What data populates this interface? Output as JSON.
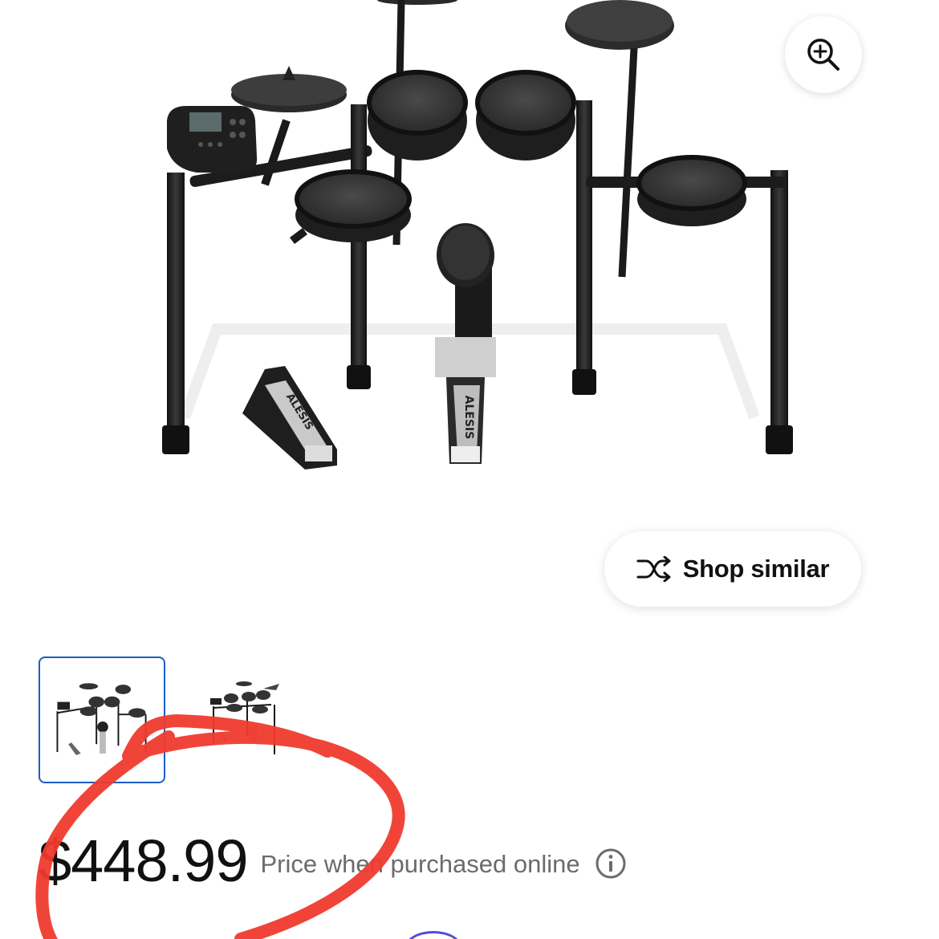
{
  "product": {
    "image_alt": "Alesis Nitro electronic drum kit",
    "brand_mark": "ALESIS"
  },
  "zoom": {
    "icon": "zoom-in-icon"
  },
  "shop_similar": {
    "label": "Shop similar",
    "icon": "shuffle-icon"
  },
  "thumbnails": [
    {
      "selected": true
    },
    {
      "selected": false
    }
  ],
  "price": {
    "amount": "$448.99",
    "note": "Price when purchased online",
    "info_icon": "info-icon"
  },
  "colors": {
    "selected_border": "#1a5dc8",
    "annotation": "#f03a2e",
    "price_note": "#6b6b6b"
  }
}
